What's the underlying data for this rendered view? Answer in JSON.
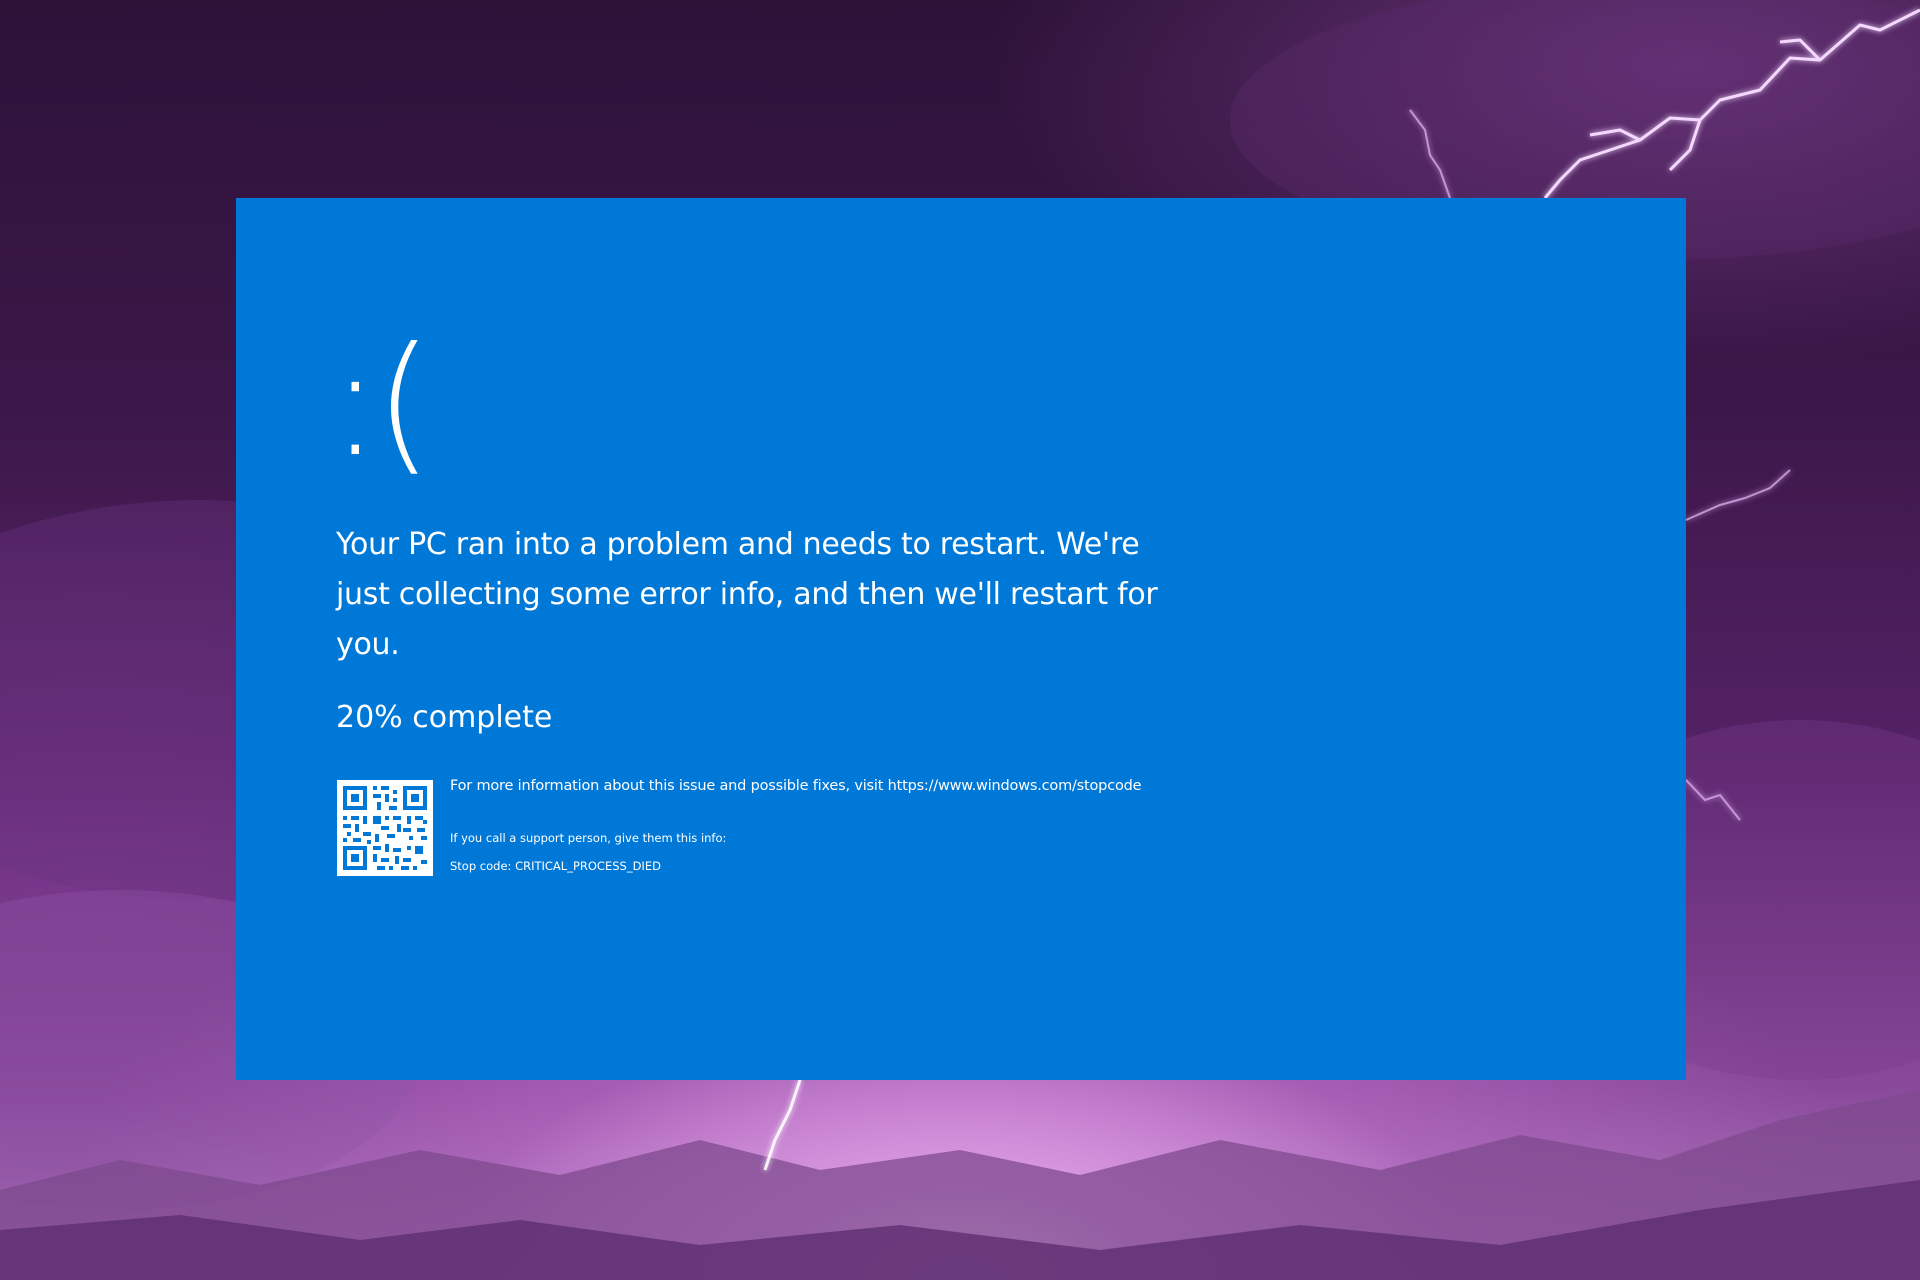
{
  "screen": {
    "background_color": "#0078d7",
    "text_color": "#ffffff",
    "emoticon": ":(",
    "message": "Your PC ran into a problem and needs to restart. We're just collecting some error info, and then we'll restart for you.",
    "progress": {
      "percent": 20,
      "text": "20% complete"
    },
    "qr_code_icon": "qr-code-icon",
    "more_info": "For more information about this issue and possible fixes, visit https://www.windows.com/stopcode",
    "support_prompt": "If you call a support person, give them this info:",
    "stop_code": "Stop code: CRITICAL_PROCESS_DIED"
  },
  "background": {
    "theme": "purple-lightning-storm",
    "colors": [
      "#2d1238",
      "#552266",
      "#b07ac0"
    ]
  }
}
